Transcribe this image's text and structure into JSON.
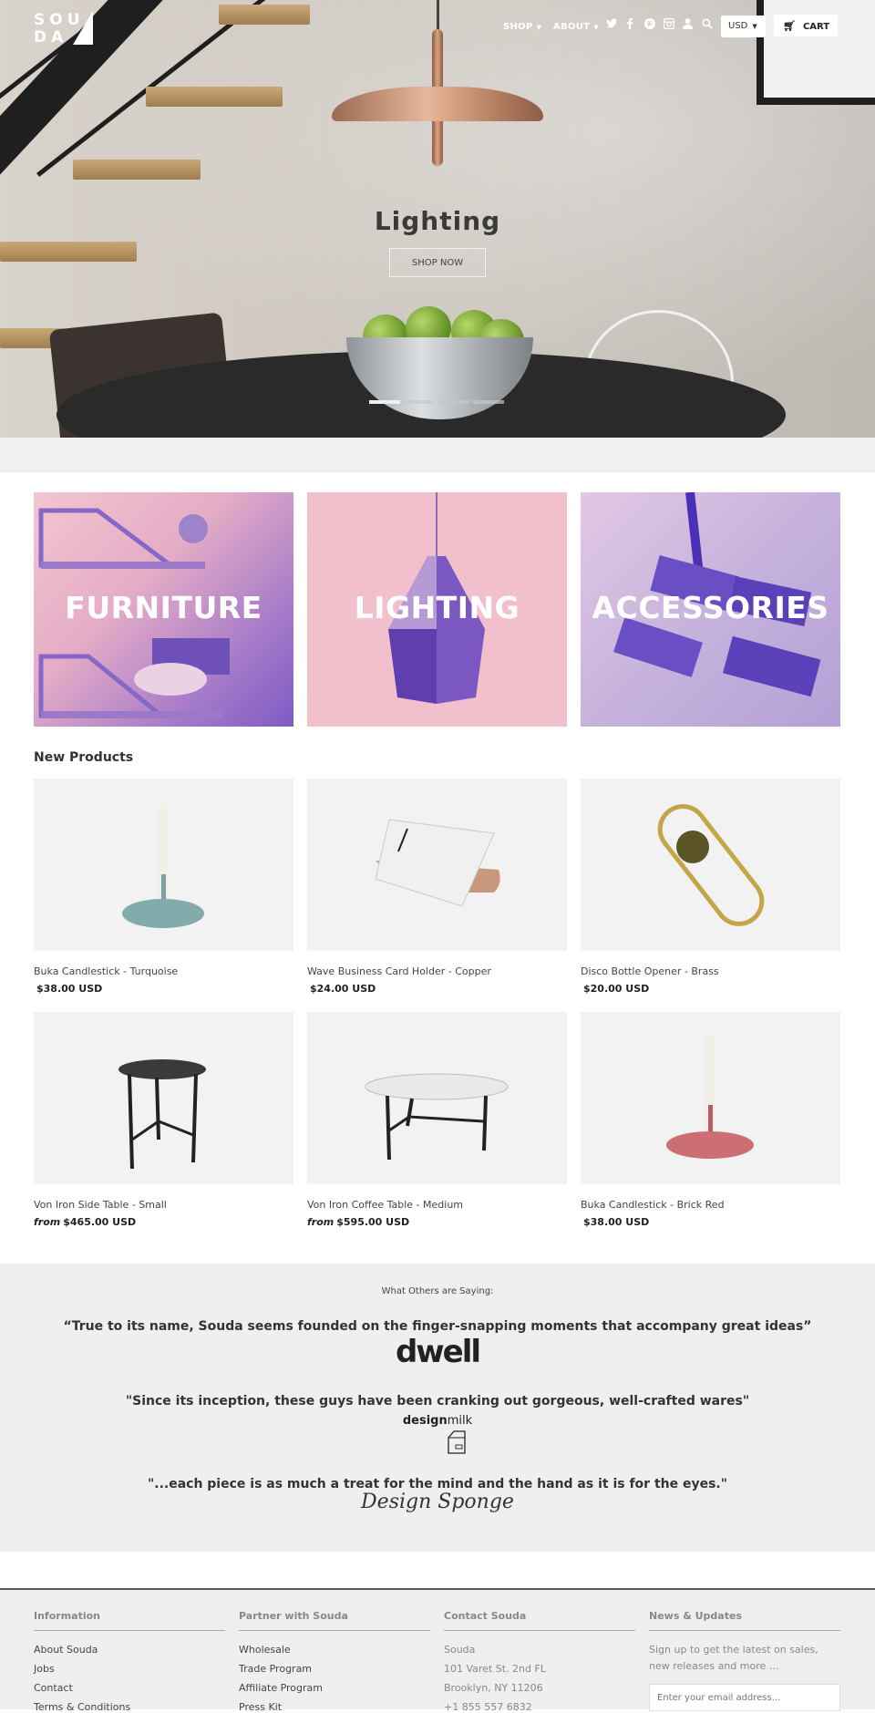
{
  "header": {
    "logo_line1": "SOU",
    "logo_line2": "DA",
    "nav": [
      {
        "label": "SHOP"
      },
      {
        "label": "ABOUT"
      }
    ],
    "icons": [
      "twitter-icon",
      "facebook-icon",
      "pinterest-icon",
      "instagram-icon",
      "user-icon",
      "search-icon"
    ],
    "currency": "USD",
    "cart_label": "CART"
  },
  "hero": {
    "title": "Lighting",
    "button": "SHOP NOW",
    "slides": 4,
    "active_slide": 1
  },
  "categories": [
    {
      "label": "FURNITURE"
    },
    {
      "label": "LIGHTING"
    },
    {
      "label": "ACCESSORIES"
    }
  ],
  "new_products": {
    "title": "New Products",
    "items": [
      {
        "name": "Buka Candlestick - Turquoise",
        "from": "",
        "price": "$38.00 USD"
      },
      {
        "name": "Wave Business Card Holder - Copper",
        "from": "",
        "price": "$24.00 USD"
      },
      {
        "name": "Disco Bottle Opener - Brass",
        "from": "",
        "price": "$20.00 USD"
      },
      {
        "name": "Von Iron Side Table - Small",
        "from": "from",
        "price": "$465.00 USD"
      },
      {
        "name": "Von Iron Coffee Table - Medium",
        "from": "from",
        "price": "$595.00 USD"
      },
      {
        "name": "Buka Candlestick - Brick Red",
        "from": "",
        "price": "$38.00 USD"
      }
    ]
  },
  "press": {
    "heading": "What Others are Saying:",
    "quotes": [
      {
        "text": "“True to its name, Souda seems founded on the finger-snapping moments that accompany great ideas”",
        "source": "dwell"
      },
      {
        "text": "\"Since its inception, these guys have been cranking out gorgeous, well-crafted wares\"",
        "source_bold": "design",
        "source_rest": "milk"
      },
      {
        "text": "\"...each piece is as much a treat for the mind and the hand as it is for the eyes.\"",
        "source": "Design Sponge"
      }
    ]
  },
  "footer": {
    "information": {
      "title": "Information",
      "links": [
        "About Souda",
        "Jobs",
        "Contact",
        "Terms & Conditions"
      ]
    },
    "partner": {
      "title": "Partner with Souda",
      "links": [
        "Wholesale",
        "Trade Program",
        "Affiliate Program",
        "Press Kit"
      ]
    },
    "contact": {
      "title": "Contact Souda",
      "lines": [
        "Souda",
        "101 Varet St. 2nd FL",
        "Brooklyn, NY 11206",
        "+1 855 557 6832"
      ]
    },
    "news": {
      "title": "News & Updates",
      "text": "Sign up to get the latest on sales, new releases and more …",
      "placeholder": "Enter your email address..."
    }
  }
}
